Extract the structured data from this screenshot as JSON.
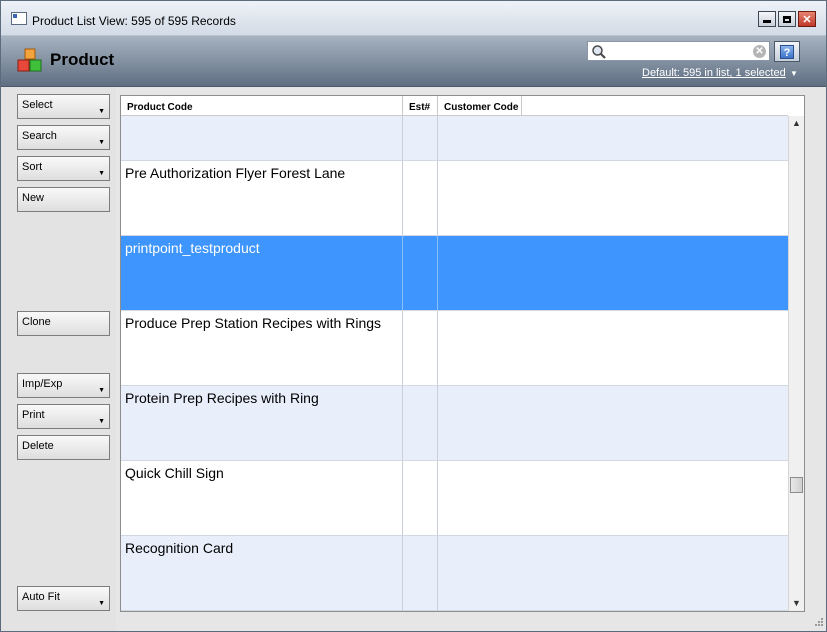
{
  "window": {
    "title": "Product List View: 595 of 595 Records",
    "minimize_glyph": "",
    "maximize_glyph": "",
    "close_glyph": "✕"
  },
  "header": {
    "title": "Product",
    "search": {
      "value": "",
      "placeholder": ""
    },
    "help_glyph": "?",
    "list_status": "Default: 595 in list, 1 selected",
    "list_status_caret": "▼",
    "icons": [
      "product-boxes-icon",
      "search-icon",
      "clear-icon",
      "help-icon"
    ]
  },
  "sidebar": {
    "select": "Select",
    "search": "Search",
    "sort": "Sort",
    "new": "New",
    "clone": "Clone",
    "imp_exp": "Imp/Exp",
    "print": "Print",
    "delete": "Delete",
    "auto_fit": "Auto Fit",
    "caret": "▼"
  },
  "grid": {
    "columns": [
      "Product Code",
      "Est#",
      "Customer Code"
    ],
    "rows": [
      {
        "product_code": "",
        "est": "",
        "customer_code": ""
      },
      {
        "product_code": "Pre Authorization Flyer Forest Lane",
        "est": "",
        "customer_code": ""
      },
      {
        "product_code": "printpoint_testproduct",
        "est": "",
        "customer_code": ""
      },
      {
        "product_code": "Produce Prep Station Recipes with Rings",
        "est": "",
        "customer_code": ""
      },
      {
        "product_code": "Protein Prep Recipes with Ring",
        "est": "",
        "customer_code": ""
      },
      {
        "product_code": "Quick Chill Sign",
        "est": "",
        "customer_code": ""
      },
      {
        "product_code": "Recognition Card",
        "est": "",
        "customer_code": ""
      }
    ],
    "selected_row": 2,
    "scroll_up_glyph": "▲",
    "scroll_down_glyph": "▼"
  },
  "colors": {
    "selection": "#3d95fd",
    "alt_row": "#e8effb",
    "header_band": "#5f6f82"
  }
}
